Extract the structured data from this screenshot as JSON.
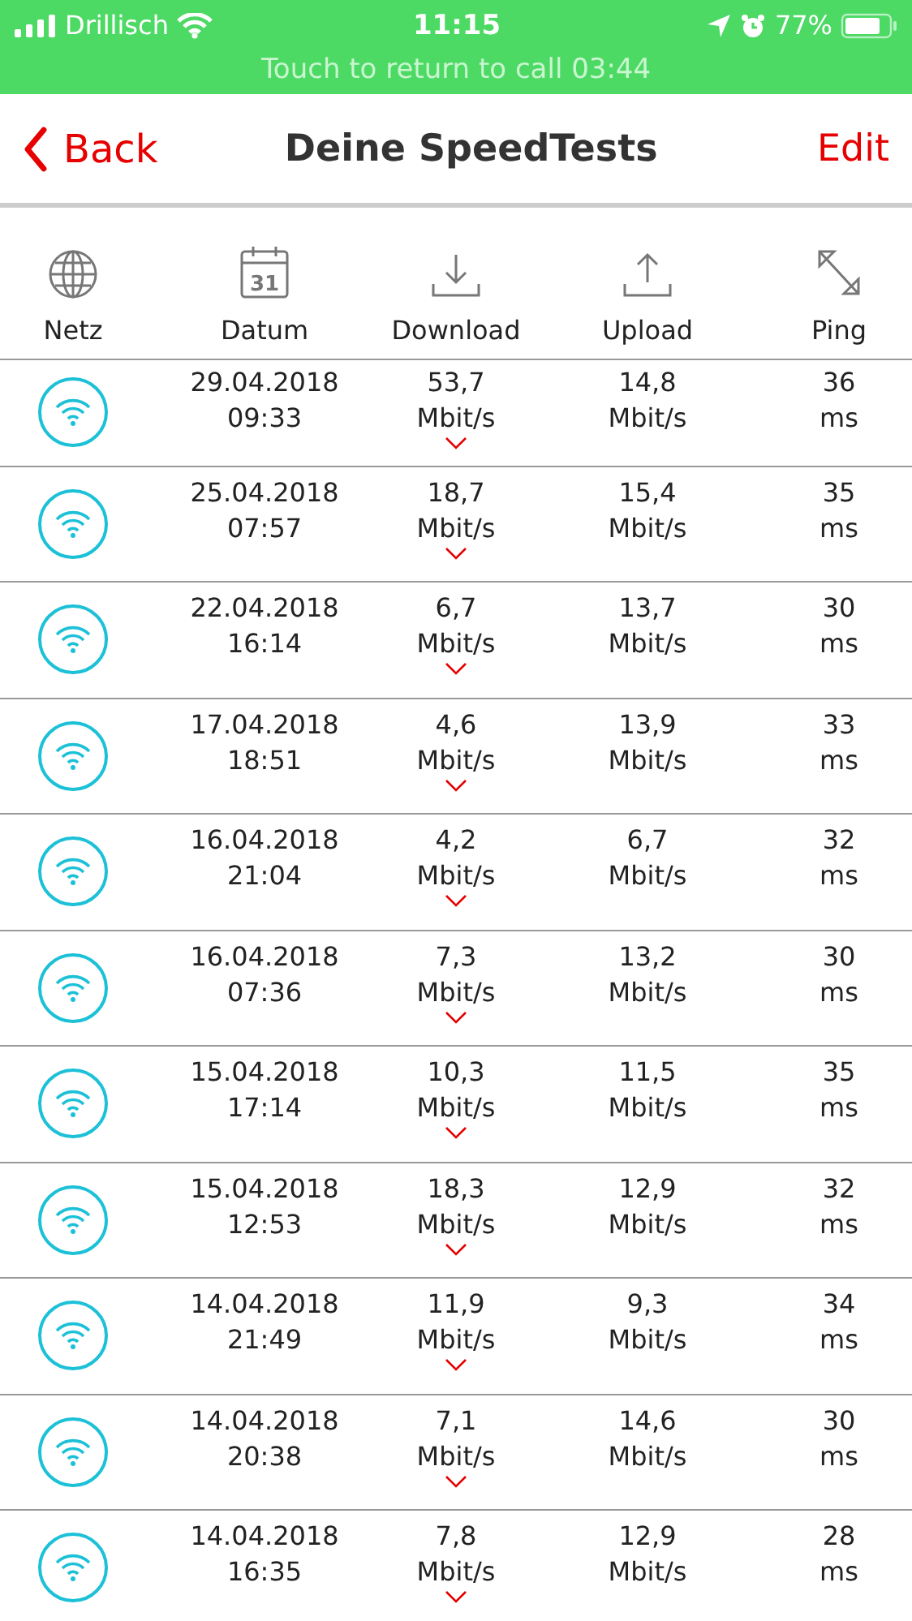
{
  "status_bar": {
    "carrier": "Drillisch",
    "time": "11:15",
    "battery": "77%",
    "call_banner": "Touch to return to call 03:44"
  },
  "nav": {
    "back": "Back",
    "title": "Deine SpeedTests",
    "edit": "Edit"
  },
  "columns": [
    {
      "label": "Netz",
      "kind": "globe"
    },
    {
      "label": "Datum",
      "kind": "calendar",
      "icon_text": "31"
    },
    {
      "label": "Download",
      "kind": "download"
    },
    {
      "label": "Upload",
      "kind": "upload"
    },
    {
      "label": "Ping",
      "kind": "ping"
    }
  ],
  "rows": [
    {
      "date": "29.04.2018",
      "time": "09:33",
      "download": "53,7",
      "download_unit": "Mbit/s",
      "upload": "14,8",
      "upload_unit": "Mbit/s",
      "ping": "36",
      "ping_unit": "ms"
    },
    {
      "date": "25.04.2018",
      "time": "07:57",
      "download": "18,7",
      "download_unit": "Mbit/s",
      "upload": "15,4",
      "upload_unit": "Mbit/s",
      "ping": "35",
      "ping_unit": "ms"
    },
    {
      "date": "22.04.2018",
      "time": "16:14",
      "download": "6,7",
      "download_unit": "Mbit/s",
      "upload": "13,7",
      "upload_unit": "Mbit/s",
      "ping": "30",
      "ping_unit": "ms"
    },
    {
      "date": "17.04.2018",
      "time": "18:51",
      "download": "4,6",
      "download_unit": "Mbit/s",
      "upload": "13,9",
      "upload_unit": "Mbit/s",
      "ping": "33",
      "ping_unit": "ms"
    },
    {
      "date": "16.04.2018",
      "time": "21:04",
      "download": "4,2",
      "download_unit": "Mbit/s",
      "upload": "6,7",
      "upload_unit": "Mbit/s",
      "ping": "32",
      "ping_unit": "ms"
    },
    {
      "date": "16.04.2018",
      "time": "07:36",
      "download": "7,3",
      "download_unit": "Mbit/s",
      "upload": "13,2",
      "upload_unit": "Mbit/s",
      "ping": "30",
      "ping_unit": "ms"
    },
    {
      "date": "15.04.2018",
      "time": "17:14",
      "download": "10,3",
      "download_unit": "Mbit/s",
      "upload": "11,5",
      "upload_unit": "Mbit/s",
      "ping": "35",
      "ping_unit": "ms"
    },
    {
      "date": "15.04.2018",
      "time": "12:53",
      "download": "18,3",
      "download_unit": "Mbit/s",
      "upload": "12,9",
      "upload_unit": "Mbit/s",
      "ping": "32",
      "ping_unit": "ms"
    },
    {
      "date": "14.04.2018",
      "time": "21:49",
      "download": "11,9",
      "download_unit": "Mbit/s",
      "upload": "9,3",
      "upload_unit": "Mbit/s",
      "ping": "34",
      "ping_unit": "ms"
    },
    {
      "date": "14.04.2018",
      "time": "20:38",
      "download": "7,1",
      "download_unit": "Mbit/s",
      "upload": "14,6",
      "upload_unit": "Mbit/s",
      "ping": "30",
      "ping_unit": "ms"
    },
    {
      "date": "14.04.2018",
      "time": "16:35",
      "download": "7,8",
      "download_unit": "Mbit/s",
      "upload": "12,9",
      "upload_unit": "Mbit/s",
      "ping": "28",
      "ping_unit": "ms"
    }
  ]
}
